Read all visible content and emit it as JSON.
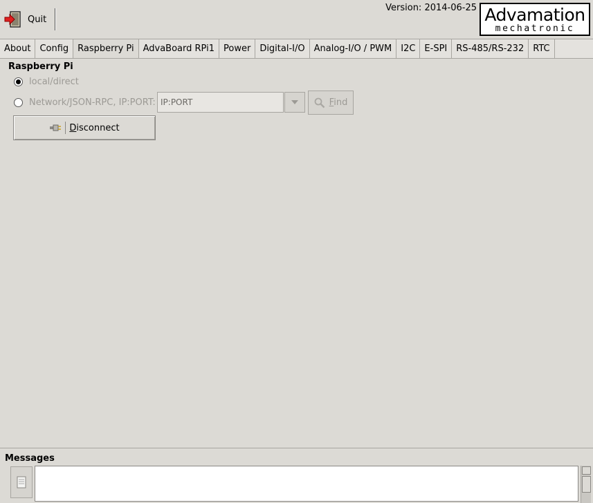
{
  "toolbar": {
    "quit_label": "Quit",
    "quit_icon": "exit-door-icon"
  },
  "version": "Version: 2014-06-25",
  "logo": {
    "main": "Advamation",
    "sub": "mechatronic"
  },
  "tabs": [
    {
      "label": "About"
    },
    {
      "label": "Config"
    },
    {
      "label": "Raspberry Pi",
      "active": true
    },
    {
      "label": "AdvaBoard RPi1"
    },
    {
      "label": "Power"
    },
    {
      "label": "Digital-I/O"
    },
    {
      "label": "Analog-I/O / PWM"
    },
    {
      "label": "I2C"
    },
    {
      "label": "E-SPI"
    },
    {
      "label": "RS-485/RS-232"
    },
    {
      "label": "RTC"
    }
  ],
  "panel": {
    "title": "Raspberry Pi",
    "radio_local": "local/direct",
    "radio_network": "Network/JSON-RPC, IP:PORT:",
    "ip_value": "IP:PORT",
    "find_first": "F",
    "find_rest": "ind",
    "disconnect_first": "D",
    "disconnect_rest": "isconnect"
  },
  "messages": {
    "title": "Messages",
    "text": ""
  },
  "colors": {
    "background": "#dcdad5",
    "disabled_text": "#9c9a95",
    "border": "#a7a5a0"
  }
}
